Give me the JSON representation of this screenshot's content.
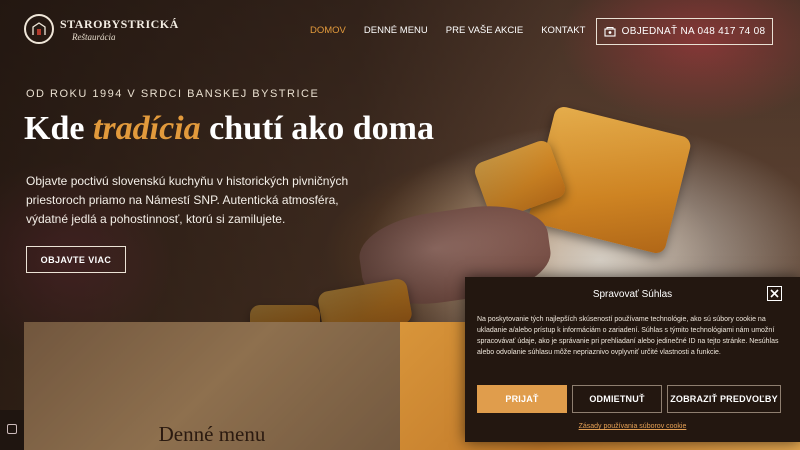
{
  "header": {
    "logo_title": "STAROBYSTRICKÁ",
    "logo_subtitle": "Reštaurácia",
    "nav": [
      {
        "label": "DOMOV",
        "active": true
      },
      {
        "label": "DENNÉ MENU",
        "active": false
      },
      {
        "label": "PRE VAŠE AKCIE",
        "active": false
      },
      {
        "label": "KONTAKT",
        "active": false
      }
    ],
    "phone_cta": "OBJEDNAŤ NA 048 417 74 08"
  },
  "hero": {
    "since": "OD ROKU 1994 V SRDCI BANSKEJ BYSTRICE",
    "headline_pre": "Kde ",
    "headline_accent": "tradícia",
    "headline_post": " chutí ako doma",
    "description": "Objavte poctivú slovenskú kuchyňu v historických pivničných priestoroch priamo na Námestí SNP. Autentická atmosféra, výdatné jedlá a pohostinnosť, ktorú si zamilujete.",
    "button": "OBJAVTE VIAC"
  },
  "cards": {
    "menu_title": "Denné menu"
  },
  "cookie": {
    "title": "Spravovať Súhlas",
    "text": "Na poskytovanie tých najlepších skúseností používame technológie, ako sú súbory cookie na ukladanie a/alebo prístup k informáciám o zariadení. Súhlas s týmito technológiami nám umožní spracovávať údaje, ako je správanie pri prehliadaní alebo jedinečné ID na tejto stránke. Nesúhlas alebo odvolanie súhlasu môže nepriaznivo ovplyvniť určité vlastnosti a funkcie.",
    "accept": "PRIJAŤ",
    "deny": "ODMIETNUŤ",
    "prefs": "ZOBRAZIŤ PREDVOĽBY",
    "policy_link": "Zásady používania súborov cookie"
  },
  "colors": {
    "accent": "#e29a3c",
    "modal_bg": "#231710"
  }
}
